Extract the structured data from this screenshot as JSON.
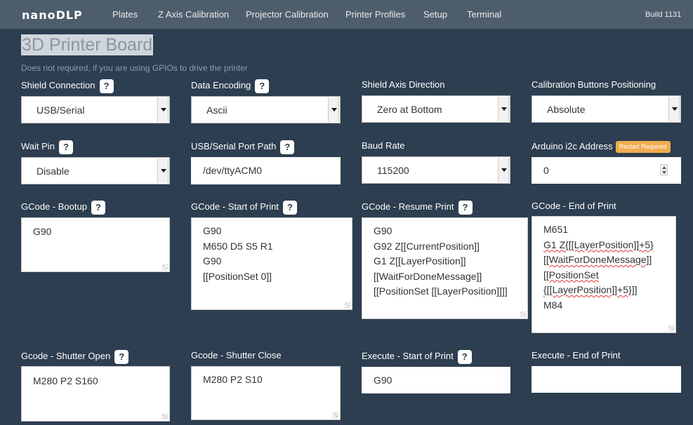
{
  "navbar": {
    "logo": "nanoDLP",
    "items": [
      "Plates",
      "Z Axis Calibration",
      "Projector Calibration",
      "Printer Profiles",
      "Setup",
      "Terminal"
    ],
    "build": "Build 1131"
  },
  "page": {
    "title": "3D Printer Board",
    "subtitle": "Does not required, if you are using GPIOs to drive the printer"
  },
  "help_glyph": "?",
  "fields": {
    "shield_connection": {
      "label": "Shield Connection",
      "value": "USB/Serial"
    },
    "data_encoding": {
      "label": "Data Encoding",
      "value": "Ascii"
    },
    "shield_axis_direction": {
      "label": "Shield Axis Direction",
      "value": "Zero at Bottom"
    },
    "calibration_buttons_positioning": {
      "label": "Calibration Buttons Positioning",
      "value": "Absolute"
    },
    "wait_pin": {
      "label": "Wait Pin",
      "value": "Disable"
    },
    "usb_serial_port_path": {
      "label": "USB/Serial Port Path",
      "value": "/dev/ttyACM0"
    },
    "baud_rate": {
      "label": "Baud Rate",
      "value": "115200"
    },
    "arduino_i2c_address": {
      "label": "Arduino i2c Address",
      "badge": "Restart Required",
      "value": "0"
    },
    "gcode_bootup": {
      "label": "GCode - Bootup",
      "lines": [
        "G90"
      ]
    },
    "gcode_start_of_print": {
      "label": "GCode - Start of Print",
      "lines": [
        "G90",
        "M650 D5 S5 R1",
        "G90",
        "[[PositionSet 0]]"
      ]
    },
    "gcode_resume_print": {
      "label": "GCode - Resume Print",
      "lines": [
        "G90",
        "G92 Z[[CurrentPosition]]",
        "G1 Z[[LayerPosition]]",
        "[[WaitForDoneMessage]]",
        "[[PositionSet [[LayerPosition]]]]"
      ]
    },
    "gcode_end_of_print": {
      "label": "GCode - End of Print",
      "lines": [
        "M651",
        "G1 Z{[[LayerPosition]]+5}",
        "[[WaitForDoneMessage]]",
        "[[PositionSet",
        "{[[LayerPosition]]+5}]]",
        "M84"
      ]
    },
    "gcode_shutter_open": {
      "label": "Gcode - Shutter Open",
      "lines": [
        "M280 P2 S160"
      ]
    },
    "gcode_shutter_close": {
      "label": "Gcode - Shutter Close",
      "lines": [
        "M280 P2 S10"
      ]
    },
    "execute_start_of_print": {
      "label": "Execute - Start of Print",
      "value": "G90"
    },
    "execute_end_of_print": {
      "label": "Execute - End of Print",
      "value": ""
    }
  }
}
